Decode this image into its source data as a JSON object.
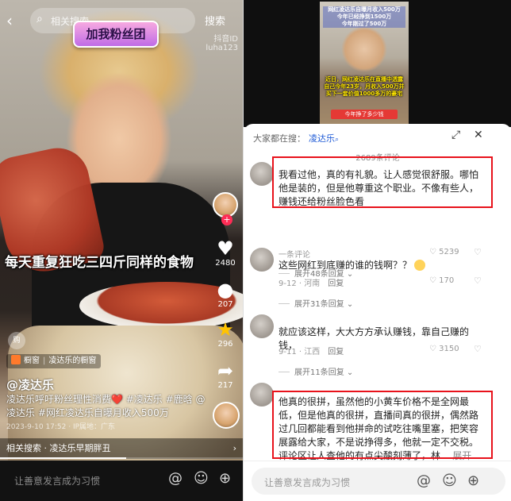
{
  "left": {
    "search": {
      "placeholder": "相关搜索",
      "button": "搜索"
    },
    "fan_banner": "加我粉丝团",
    "douyin_id": "抖音ID\nluha123",
    "overlay_caption": "每天重复狂吃三四斤同样的食物",
    "actions": [
      {
        "icon": "heart-icon",
        "count": "2480"
      },
      {
        "icon": "comment-icon",
        "count": "207"
      },
      {
        "icon": "star-icon",
        "count": "296"
      },
      {
        "icon": "share-icon",
        "count": "217"
      }
    ],
    "shop_badge": "购",
    "shop_chip": {
      "label": "橱窗",
      "name": "凌达乐的橱窗"
    },
    "author": "@凌达乐",
    "description": "凌达乐呼吁粉丝理性消费❤️ #凌达乐 #鹿晗 @凌达乐 #网红凌达乐自曝月收入500万",
    "meta": "2023-9-10 17:52 · IP属地：广东",
    "related": "相关搜索 · 凌达乐早期胖丑",
    "progress_fraction": 0.52,
    "input_placeholder": "让善意发言成为习惯",
    "input_icons": [
      "at-icon",
      "emoji-icon",
      "plus-icon"
    ]
  },
  "right": {
    "thumb": {
      "top_text": "网红凌达乐自曝月收入500万\n今年已经挣到1500万\n今年刚过了500万",
      "mid_text": "近日，网红凌达乐在直播中透露自己今年23岁，月收入500万并买下一套价值1000多万的豪宅",
      "badge": "今年挣了多少钱"
    },
    "header": {
      "prefix": "大家都在搜：",
      "keyword": "凌达乐"
    },
    "comment_count": "2689条评论",
    "comments": [
      {
        "text": "我看过他，真的有礼貌。让人感觉很舒服。哪怕他是装的，但是他尊重这个职业。不像有些人，赚钱还给粉丝脸色看",
        "likes": "5239",
        "expand": "展开48条回复"
      },
      {
        "name": "一条评论",
        "text": "这些网红到底赚的谁的钱啊？？",
        "time": "9-12 · 河南",
        "reply": "回复",
        "likes": "170",
        "expand": "展开31条回复"
      },
      {
        "text": "就应该这样，大大方方承认赚钱，靠自己赚的钱，",
        "time": "9-11 · 江西",
        "reply": "回复",
        "likes": "3150",
        "expand": "展开11条回复"
      },
      {
        "text": "他真的很拼，虽然他的小黄车价格不是全网最低，但是他真的很拼，直播间真的很拼，偶然路过几回都能看到他拼命的试吃往嘴里塞，把笑容展露给大家，不是说挣得多，他就一定不交税。评论区让人查他的有点尖酸刻薄了，林...",
        "more": "展开"
      }
    ],
    "input_placeholder": "让善意发言成为习惯",
    "input_icons": [
      "at-icon",
      "emoji-icon",
      "plus-icon"
    ],
    "highlight_color": "#e8121b"
  }
}
